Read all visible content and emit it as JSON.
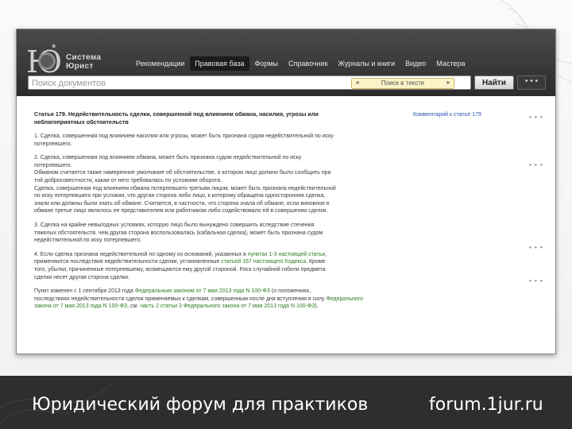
{
  "logo": {
    "line1": "Система",
    "line2": "Юрист"
  },
  "nav": [
    {
      "label": "Рекомендации",
      "active": false
    },
    {
      "label": "Правовая база",
      "active": true
    },
    {
      "label": "Формы",
      "active": false
    },
    {
      "label": "Справочник",
      "active": false
    },
    {
      "label": "Журналы и книги",
      "active": false
    },
    {
      "label": "Видео",
      "active": false
    },
    {
      "label": "Мастера",
      "active": false
    }
  ],
  "search": {
    "placeholder": "Поиск документов",
    "scope": "Поиск в тексте",
    "find_label": "Найти",
    "more_label": "• • •"
  },
  "doc": {
    "title_line1": "Статья 179. Недействительность сделки, совершенной под влиянием обмана, насилия, угрозы или",
    "title_line2": "неблагоприятных обстоятельств",
    "comment_link": "Комментарий к статье 179",
    "p1": [
      "1. Сделка, совершенная под влиянием насилия или угрозы, может быть признана судом недействительной по иску",
      "потерпевшего."
    ],
    "p2": [
      "2. Сделка, совершенная под влиянием обмана, может быть признана судом недействительной по иску",
      "потерпевшего.",
      "Обманом считается также намеренное умолчание об обстоятельстве, о котором лицо должно было сообщить при",
      "той добросовестности, какая от него требовалась по условиям оборота.",
      "Сделка, совершенная под влиянием обмана потерпевшего третьим лицом, может быть признана недействительной",
      "по иску потерпевшего при условии, что другая сторона либо лицо, к которому обращена односторонняя сделка,",
      "знали или должны были знать об обмане. Считается, в частности, что сторона знала об обмане, если виновное в",
      "обмане третье лицо являлось ее представителем или работником либо содействовало ей в совершении сделки."
    ],
    "p3": [
      "3. Сделка на крайне невыгодных условиях, которую лицо было вынуждено совершить вследствие стечения",
      "тяжелых обстоятельств, чем другая сторона воспользовалась (кабальная сделка), может быть признана судом",
      "недействительной по иску потерпевшего."
    ],
    "p4_a": "4. Если сделка признана недействительной по одному из оснований, указанных в ",
    "p4_link1": "пунктах 1-3 настоящей статьи",
    "p4_b": ",",
    "p4_c": "применяются последствия недействительности сделки, установленные ",
    "p4_link2": "статьей 167 настоящего Кодекса",
    "p4_d": ". Кроме",
    "p4_e": "того, убытки, причиненные потерпевшему, возмещаются ему другой стороной. Риск случайной гибели предмета",
    "p4_f": "сделки несет другая сторона сделки.",
    "note_a": "Пункт изменен с 1 сентября 2013 года ",
    "note_link1": "Федеральным законом от 7 мая 2013 года N 100-ФЗ",
    "note_b": " (о положениях,",
    "note_c": "последствиях недействительности сделок применяемых к сделкам, совершенным после дня вступления в силу ",
    "note_link2": "Федерального",
    "note_d": "закона от 7 мая 2013 года N 100-ФЗ",
    "note_e": ", см. ",
    "note_link3": "часть 2 статьи 3 Федерального закона от 7 мая 2013 года N 100-ФЗ",
    "note_f": ")."
  },
  "footer": {
    "left": "Юридический форум для практиков",
    "right": "forum.1jur.ru"
  }
}
